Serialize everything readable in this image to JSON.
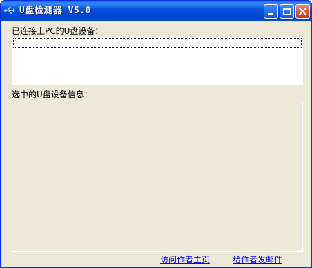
{
  "window": {
    "title": "U盘检测器 V5.0",
    "icon": "usb-icon"
  },
  "titlebar_buttons": {
    "minimize": "minimize-icon",
    "maximize": "maximize-icon",
    "close": "close-icon"
  },
  "devices": {
    "label": "已连接上PC的U盘设备：",
    "items": []
  },
  "info": {
    "label": "选中的U盘设备信息：",
    "content": ""
  },
  "links": {
    "homepage": "访问作者主页",
    "email": "给作者发邮件"
  },
  "colors": {
    "titlebar": "#0054e3",
    "window_bg": "#ece9d8",
    "link": "#0000ff",
    "close_button": "#e0573a"
  }
}
